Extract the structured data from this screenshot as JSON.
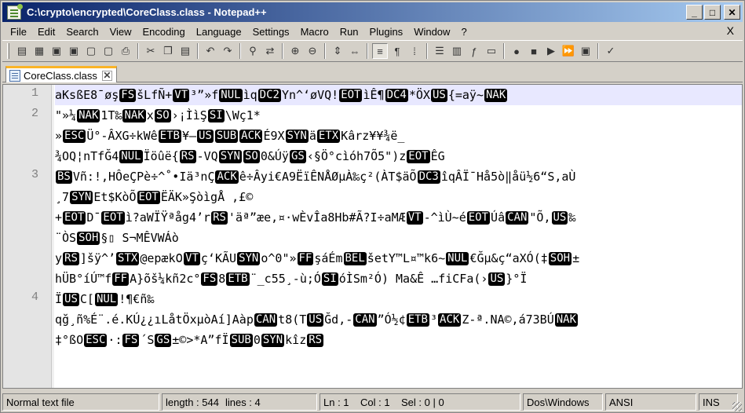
{
  "window": {
    "title": "C:\\crypto\\encrypted\\CoreClass.class - Notepad++",
    "controls": {
      "minimize": "_",
      "maximize": "□",
      "close": "✕"
    }
  },
  "menu": {
    "items": [
      "File",
      "Edit",
      "Search",
      "View",
      "Encoding",
      "Language",
      "Settings",
      "Macro",
      "Run",
      "Plugins",
      "Window",
      "?"
    ],
    "close": "X"
  },
  "toolbar": {
    "icons": [
      "new-file-icon",
      "open-file-icon",
      "save-icon",
      "save-all-icon",
      "close-icon",
      "close-all-icon",
      "print-icon",
      "cut-icon",
      "copy-icon",
      "paste-icon",
      "undo-icon",
      "redo-icon",
      "find-icon",
      "replace-icon",
      "zoom-in-icon",
      "zoom-out-icon",
      "sync-vertical-icon",
      "sync-horizontal-icon",
      "word-wrap-icon",
      "show-all-chars-icon",
      "indent-guide-icon",
      "user-lang-icon",
      "doc-map-icon",
      "function-list-icon",
      "folder-workspace-icon",
      "record-macro-icon",
      "stop-macro-icon",
      "play-macro-icon",
      "play-multiple-icon",
      "save-macro-icon",
      "spellcheck-icon"
    ]
  },
  "tab": {
    "label": "CoreClass.class",
    "close": "✕",
    "accent": "#fab427"
  },
  "editor": {
    "line_numbers": [
      "1",
      "2",
      "3",
      "4"
    ],
    "rows": [
      {
        "segs": [
          [
            "t",
            "aKsßE8¯øş"
          ],
          [
            "c",
            "FS"
          ],
          [
            "t",
            "šLfÑ+"
          ],
          [
            "c",
            "VT"
          ],
          [
            "t",
            "³”»f"
          ],
          [
            "c",
            "NUL"
          ],
          [
            "t",
            "ìq"
          ],
          [
            "c",
            "DC2"
          ],
          [
            "t",
            "Yn^‘øVQ!"
          ],
          [
            "c",
            "EOT"
          ],
          [
            "t",
            "ìÊ¶"
          ],
          [
            "c",
            "DC4"
          ],
          [
            "t",
            "*ÖX"
          ],
          [
            "c",
            "US"
          ],
          [
            "t",
            "{=aÿ~"
          ],
          [
            "c",
            "NAK"
          ]
        ]
      },
      {
        "segs": [
          [
            "t",
            "\"»¼"
          ],
          [
            "c",
            "NAK"
          ],
          [
            "t",
            "1T‰"
          ],
          [
            "c",
            "NAK"
          ],
          [
            "t",
            "x"
          ],
          [
            "c",
            "SO"
          ],
          [
            "t",
            "›¡ÌìŞ"
          ],
          [
            "c",
            "SI"
          ],
          [
            "t",
            "\\Wç1*"
          ]
        ]
      },
      {
        "segs": [
          [
            "t",
            "»"
          ],
          [
            "c",
            "ESC"
          ],
          [
            "t",
            "Ü°-ÂXG÷kWê"
          ],
          [
            "c",
            "ETB"
          ],
          [
            "t",
            "¥—"
          ],
          [
            "c",
            "US"
          ],
          [
            "c",
            "SUB"
          ],
          [
            "c",
            "ACK"
          ],
          [
            "t",
            "É9X"
          ],
          [
            "c",
            "SYN"
          ],
          [
            "t",
            "ä"
          ],
          [
            "c",
            "ETX"
          ],
          [
            "t",
            "Kârz¥¥¾ë_"
          ]
        ]
      },
      {
        "segs": [
          [
            "t",
            "¾OQ¦nTfĞ4"
          ],
          [
            "c",
            "NUL"
          ],
          [
            "t",
            "Ïöûë{"
          ],
          [
            "c",
            "RS"
          ],
          [
            "t",
            "-VQ"
          ],
          [
            "c",
            "SYN"
          ],
          [
            "c",
            "SO"
          ],
          [
            "t",
            "0&Úÿ"
          ],
          [
            "c",
            "GS"
          ],
          [
            "t",
            "‹§Ö°cìóh7Õ5\")z"
          ],
          [
            "c",
            "EOT"
          ],
          [
            "t",
            "ÊG"
          ]
        ]
      },
      {
        "segs": [
          [
            "c",
            "BS"
          ],
          [
            "t",
            "Vñ:!,HÔeÇPè÷^˚•Iä³nÇ"
          ],
          [
            "c",
            "ACK"
          ],
          [
            "t",
            "ê÷Âyi€A9ËïÊNÅØµÀ‰ç²(ÀT$äÕ"
          ],
          [
            "c",
            "DC3"
          ],
          [
            "t",
            "îqÂÏ¯Hå5ò‖åü½6“S,aÙ"
          ]
        ]
      },
      {
        "segs": [
          [
            "t",
            "¸7"
          ],
          [
            "c",
            "SYN"
          ],
          [
            "t",
            "Et$KòÕ"
          ],
          [
            "c",
            "EOT"
          ],
          [
            "t",
            "ËÄK»ŞòìgÅ ,£©"
          ]
        ]
      },
      {
        "segs": [
          [
            "t",
            "+"
          ],
          [
            "c",
            "EOT"
          ],
          [
            "t",
            "D¯"
          ],
          [
            "c",
            "EOT"
          ],
          [
            "t",
            "ì?aWÏŸªåg4’r"
          ],
          [
            "c",
            "RS"
          ],
          [
            "t",
            "'äª”æe,¤·wÈvÎa8Hb#Ã?I÷aMÆ"
          ],
          [
            "c",
            "VT"
          ],
          [
            "t",
            "-^ìÙ~é"
          ],
          [
            "c",
            "EOT"
          ],
          [
            "t",
            "Úâ"
          ],
          [
            "c",
            "CAN"
          ],
          [
            "t",
            "\"Õ,"
          ],
          [
            "c",
            "US"
          ],
          [
            "t",
            "‰"
          ]
        ]
      },
      {
        "segs": [
          [
            "t",
            "¨ÒS"
          ],
          [
            "c",
            "SOH"
          ],
          [
            "t",
            "§▯ S¬MÊVWÁò"
          ]
        ]
      },
      {
        "segs": [
          [
            "t",
            "y"
          ],
          [
            "c",
            "RS"
          ],
          [
            "t",
            "]šÿ^’"
          ],
          [
            "c",
            "STX"
          ],
          [
            "t",
            "@epæk߀"
          ],
          [
            "c",
            "VT"
          ],
          [
            "t",
            "ç‘KÃU"
          ],
          [
            "c",
            "SYN"
          ],
          [
            "t",
            "o^0\"»"
          ],
          [
            "c",
            "FF"
          ],
          [
            "t",
            "şáÉm"
          ],
          [
            "c",
            "BEL"
          ],
          [
            "t",
            "šetY™L¤™k6~"
          ],
          [
            "c",
            "NUL"
          ],
          [
            "t",
            "€Ğµ&ç“aXÓ(‡"
          ],
          [
            "c",
            "SOH"
          ],
          [
            "t",
            "±"
          ]
        ]
      },
      {
        "segs": [
          [
            "t",
            "hÜB°íÚ™f"
          ],
          [
            "c",
            "FF"
          ],
          [
            "t",
            "A}õš¼kñ2c°"
          ],
          [
            "c",
            "FS"
          ],
          [
            "t",
            "8"
          ],
          [
            "c",
            "ETB"
          ],
          [
            "t",
            "¨_c55¸-ù;Ó"
          ],
          [
            "c",
            "SI"
          ],
          [
            "t",
            "óÌSm²Ó) Ma&Ê …fiCFa(›"
          ],
          [
            "c",
            "US"
          ],
          [
            "t",
            "}°Ï"
          ]
        ]
      },
      {
        "segs": [
          [
            "t",
            "Ï"
          ],
          [
            "c",
            "US"
          ],
          [
            "t",
            "C["
          ],
          [
            "c",
            "NUL"
          ],
          [
            "t",
            "!¶€ñ‰"
          ]
        ]
      },
      {
        "segs": [
          [
            "t",
            "qğ¸ñ%É¨.é.KÚ¿¿ıLåtÖxµòAí]Aàp"
          ],
          [
            "c",
            "CAN"
          ],
          [
            "t",
            "t8(T"
          ],
          [
            "c",
            "US"
          ],
          [
            "t",
            "Ğd,-"
          ],
          [
            "c",
            "CAN"
          ],
          [
            "t",
            "”Ó½¢"
          ],
          [
            "c",
            "ETB"
          ],
          [
            "t",
            "³"
          ],
          [
            "c",
            "ACK"
          ],
          [
            "t",
            "Z-ª.NA©,á73BÚ"
          ],
          [
            "c",
            "NAK"
          ]
        ]
      },
      {
        "segs": [
          [
            "t",
            "‡°ßO"
          ],
          [
            "c",
            "ESC"
          ],
          [
            "t",
            "·:"
          ],
          [
            "c",
            "FS"
          ],
          [
            "t",
            "´S"
          ],
          [
            "c",
            "GS"
          ],
          [
            "t",
            "±©>*A”fÏ"
          ],
          [
            "c",
            "SUB"
          ],
          [
            "t",
            "0"
          ],
          [
            "c",
            "SYN"
          ],
          [
            "t",
            "kîz"
          ],
          [
            "c",
            "RS"
          ]
        ]
      }
    ]
  },
  "status": {
    "type": "Normal text file",
    "length": "length : 544",
    "lines": "lines : 4",
    "position": "Ln : 1    Col : 1    Sel : 0 | 0",
    "eol": "Dos\\Windows",
    "encoding": "ANSI",
    "mode": "INS"
  }
}
